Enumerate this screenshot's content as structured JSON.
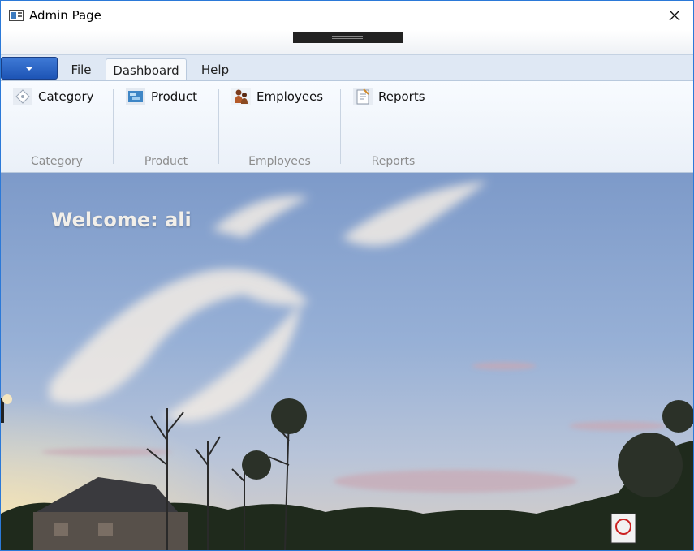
{
  "window": {
    "title": "Admin Page"
  },
  "ribbon": {
    "tabs": [
      {
        "label": "File"
      },
      {
        "label": "Dashboard"
      },
      {
        "label": "Help"
      }
    ],
    "active_tab": "Dashboard",
    "groups": [
      {
        "button": "Category",
        "group_label": "Category",
        "icon": "category-icon"
      },
      {
        "button": "Product",
        "group_label": "Product",
        "icon": "product-icon"
      },
      {
        "button": "Employees",
        "group_label": "Employees",
        "icon": "employees-icon"
      },
      {
        "button": "Reports",
        "group_label": "Reports",
        "icon": "reports-icon"
      }
    ]
  },
  "main": {
    "welcome_text": "Welcome: ali"
  },
  "colors": {
    "accent": "#2b79d8",
    "app_menu": "#1d54b5",
    "group_label": "#8d8d8d",
    "welcome_text": "#f2efe9"
  }
}
